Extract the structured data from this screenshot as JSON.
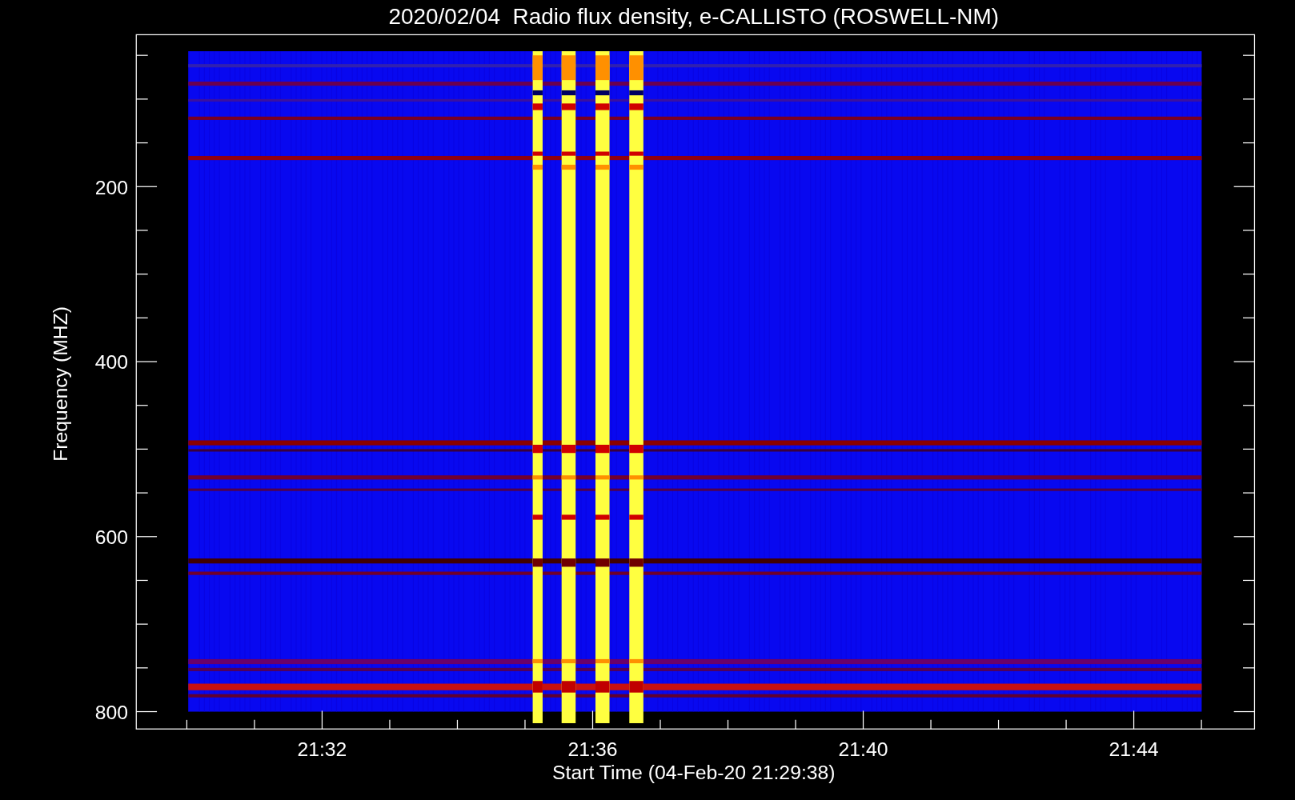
{
  "title": "2020/02/04  Radio flux density, e-CALLISTO (ROSWELL-NM)",
  "y_axis": {
    "label": "Frequency (MHZ)",
    "tick_labels": [
      "200",
      "400",
      "600",
      "800"
    ]
  },
  "x_axis": {
    "label": "Start Time (04-Feb-20 21:29:38)",
    "tick_labels": [
      "21:32",
      "21:36",
      "21:40",
      "21:44"
    ]
  }
}
